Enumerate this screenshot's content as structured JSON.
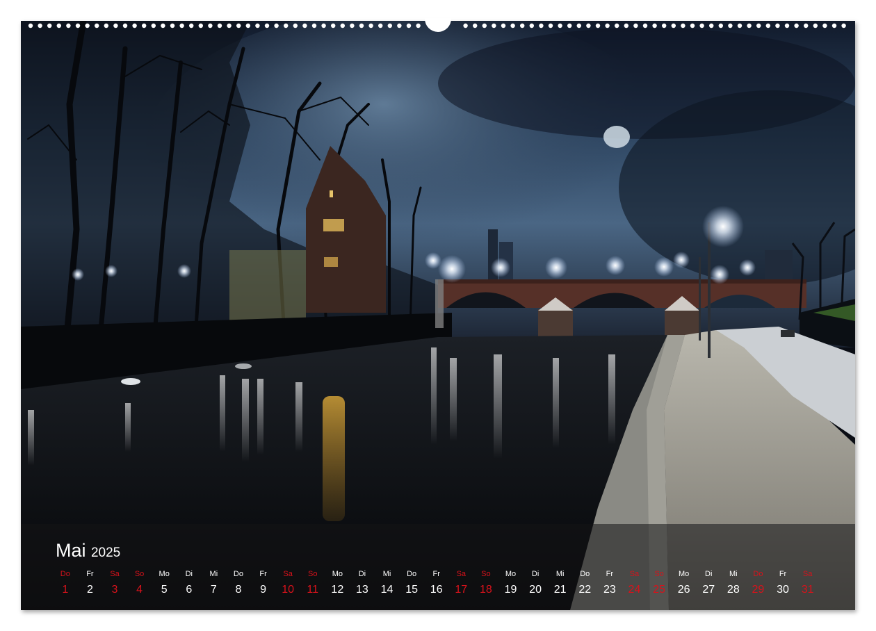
{
  "calendar": {
    "month": "Mai",
    "year": "2025",
    "days": [
      {
        "wd": "Do",
        "n": "1",
        "red": true
      },
      {
        "wd": "Fr",
        "n": "2",
        "red": false
      },
      {
        "wd": "Sa",
        "n": "3",
        "red": true
      },
      {
        "wd": "So",
        "n": "4",
        "red": true
      },
      {
        "wd": "Mo",
        "n": "5",
        "red": false
      },
      {
        "wd": "Di",
        "n": "6",
        "red": false
      },
      {
        "wd": "Mi",
        "n": "7",
        "red": false
      },
      {
        "wd": "Do",
        "n": "8",
        "red": false
      },
      {
        "wd": "Fr",
        "n": "9",
        "red": false
      },
      {
        "wd": "Sa",
        "n": "10",
        "red": true
      },
      {
        "wd": "So",
        "n": "11",
        "red": true
      },
      {
        "wd": "Mo",
        "n": "12",
        "red": false
      },
      {
        "wd": "Di",
        "n": "13",
        "red": false
      },
      {
        "wd": "Mi",
        "n": "14",
        "red": false
      },
      {
        "wd": "Do",
        "n": "15",
        "red": false
      },
      {
        "wd": "Fr",
        "n": "16",
        "red": false
      },
      {
        "wd": "Sa",
        "n": "17",
        "red": true
      },
      {
        "wd": "So",
        "n": "18",
        "red": true
      },
      {
        "wd": "Mo",
        "n": "19",
        "red": false
      },
      {
        "wd": "Di",
        "n": "20",
        "red": false
      },
      {
        "wd": "Mi",
        "n": "21",
        "red": false
      },
      {
        "wd": "Do",
        "n": "22",
        "red": false
      },
      {
        "wd": "Fr",
        "n": "23",
        "red": false
      },
      {
        "wd": "Sa",
        "n": "24",
        "red": true
      },
      {
        "wd": "So",
        "n": "25",
        "red": true
      },
      {
        "wd": "Mo",
        "n": "26",
        "red": false
      },
      {
        "wd": "Di",
        "n": "27",
        "red": false
      },
      {
        "wd": "Mi",
        "n": "28",
        "red": false
      },
      {
        "wd": "Do",
        "n": "29",
        "red": true
      },
      {
        "wd": "Fr",
        "n": "30",
        "red": false
      },
      {
        "wd": "Sa",
        "n": "31",
        "red": true
      }
    ]
  },
  "colors": {
    "holiday": "#d8121b",
    "text": "#ffffff",
    "sky_top": "#0f1626",
    "sky_mid": "#3d5a7a"
  }
}
